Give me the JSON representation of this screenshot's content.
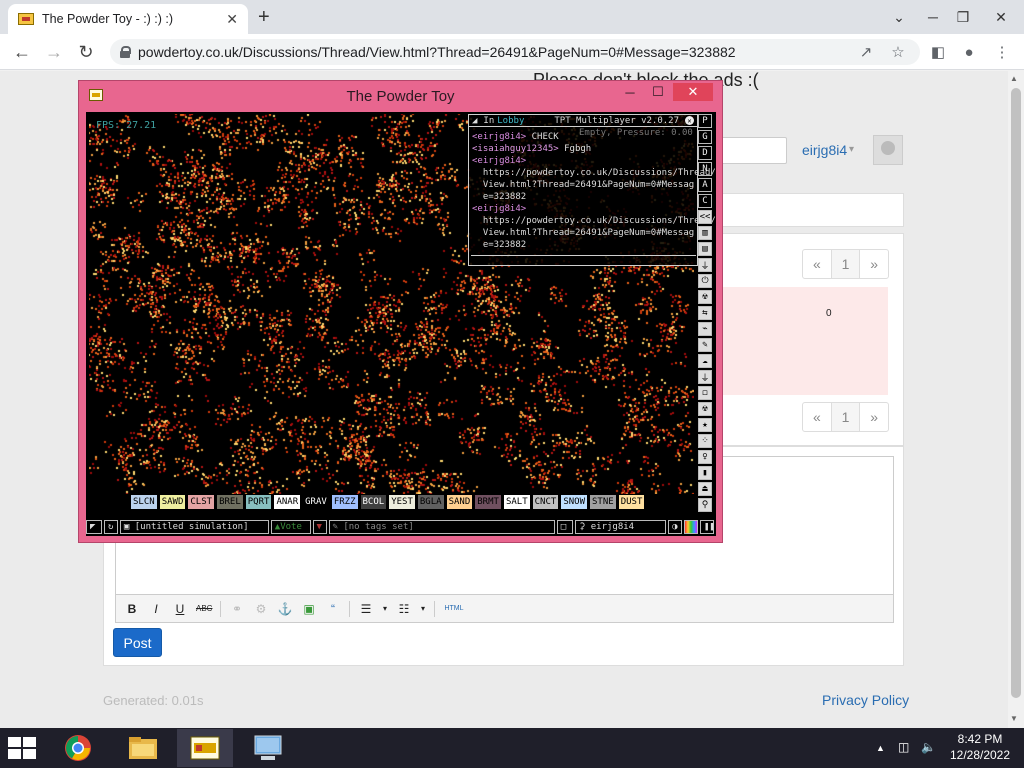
{
  "browser": {
    "tab_title": "The Powder Toy - :) :) :)",
    "tab_close": "✕",
    "new_tab": "+",
    "url": "powdertoy.co.uk/Discussions/Thread/View.html?Thread=26491&PageNum=0#Message=323882",
    "window_controls": {
      "dropdown": "⌄",
      "minimize": "─",
      "maximize": "❐",
      "close": "✕"
    }
  },
  "page": {
    "ad_text": "Please don't block the ads :(",
    "user": {
      "name": "eirjg8i4",
      "caret": "▾"
    },
    "pager_top": {
      "prev": "«",
      "current": "1",
      "next": "»"
    },
    "pager_bottom": {
      "prev": "«",
      "current": "1",
      "next": "»"
    },
    "post_count": "0",
    "editor_buttons": [
      "B",
      "I",
      "U",
      "ABC",
      "⚭",
      "⚙",
      "⚓",
      "▣",
      "“",
      "☰",
      "▾",
      "☷",
      "▾",
      "HTML"
    ],
    "post_button": "Post",
    "generated": "Generated: 0.01s",
    "privacy": "Privacy Policy"
  },
  "tpt": {
    "window_title": "The Powder Toy",
    "fps": "FPS: 27.21",
    "chat": {
      "in_label": "In",
      "channel": "Lobby",
      "version": "TPT Multiplayer v2.0.27",
      "pressure": "Empty, Pressure: 0.00",
      "lines": [
        {
          "nick": "eirjg8i4",
          "msg": " CHECK"
        },
        {
          "nick": "isaiahguy12345",
          "msg": " Fgbgh"
        },
        {
          "nick": "eirjg8i4",
          "msg": ""
        },
        {
          "nick": "",
          "msg": "  https://powdertoy.co.uk/Discussions/Thread/"
        },
        {
          "nick": "",
          "msg": "  View.html?Thread=26491&PageNum=0#Messag"
        },
        {
          "nick": "",
          "msg": "  e=323882"
        },
        {
          "nick": "eirjg8i4",
          "msg": ""
        },
        {
          "nick": "",
          "msg": "  https://powdertoy.co.uk/Discussions/Thread/"
        },
        {
          "nick": "",
          "msg": "  View.html?Thread=26491&PageNum=0#Messag"
        },
        {
          "nick": "",
          "msg": "  e=323882"
        }
      ]
    },
    "sidebar": [
      "P",
      "G",
      "D",
      "N",
      "A",
      "C",
      "<<",
      "▥",
      "▤",
      "⏚",
      "⏻",
      "☢",
      "⇆",
      "⌁",
      "✎",
      "☁",
      "⏚",
      "◻",
      "☢",
      "★",
      "⁘",
      "♀",
      "▮",
      "⏏",
      "⚲"
    ],
    "elements": [
      {
        "name": "SLCN",
        "bg": "#bcd3ee",
        "fg": "#000000"
      },
      {
        "name": "SAWD",
        "bg": "#f0f0a0",
        "fg": "#000000"
      },
      {
        "name": "CLST",
        "bg": "#e4a4a4",
        "fg": "#000000"
      },
      {
        "name": "BREL",
        "bg": "#707060",
        "fg": "#000000"
      },
      {
        "name": "PQRT",
        "bg": "#88c0c0",
        "fg": "#000000"
      },
      {
        "name": "ANAR",
        "bg": "#ffffff",
        "fg": "#000000"
      },
      {
        "name": "GRAV",
        "bg": "#000000",
        "fg": "#ffffff"
      },
      {
        "name": "FRZZ",
        "bg": "#a0c0ff",
        "fg": "#000000"
      },
      {
        "name": "BCOL",
        "bg": "#404040",
        "fg": "#ffffff"
      },
      {
        "name": "YEST",
        "bg": "#eeeedd",
        "fg": "#000000"
      },
      {
        "name": "BGLA",
        "bg": "#606060",
        "fg": "#000000"
      },
      {
        "name": "SAND",
        "bg": "#ffd090",
        "fg": "#000000"
      },
      {
        "name": "BRMT",
        "bg": "#705060",
        "fg": "#000000"
      },
      {
        "name": "SALT",
        "bg": "#ffffff",
        "fg": "#000000"
      },
      {
        "name": "CNCT",
        "bg": "#c0c0c0",
        "fg": "#000000"
      },
      {
        "name": "SNOW",
        "bg": "#c0e0ff",
        "fg": "#000000"
      },
      {
        "name": "STNE",
        "bg": "#a0a0a0",
        "fg": "#000000"
      },
      {
        "name": "DUST",
        "bg": "#ffe0a0",
        "fg": "#000000"
      }
    ],
    "bottom": {
      "save_name": "[untitled simulation]",
      "vote": "Vote",
      "tags": "[no tags set]",
      "user": "eirjg8i4"
    }
  },
  "taskbar": {
    "time": "8:42 PM",
    "date": "12/28/2022",
    "tray_up": "▲"
  }
}
